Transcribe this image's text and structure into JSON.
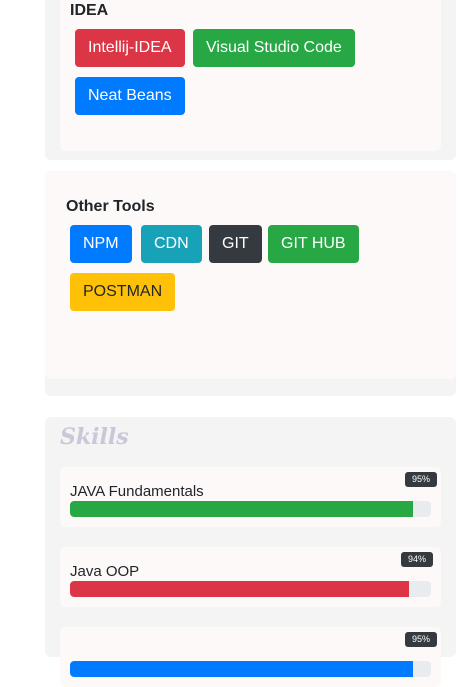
{
  "idea": {
    "title": "IDEA",
    "buttons": [
      {
        "label": "Intellij-IDEA",
        "color": "#dc3545"
      },
      {
        "label": "Visual Studio Code",
        "color": "#28a745"
      },
      {
        "label": "Neat Beans",
        "color": "#007bff"
      }
    ]
  },
  "tools": {
    "title": "Other Tools",
    "buttons": [
      {
        "label": "NPM",
        "color": "#007bff"
      },
      {
        "label": "CDN",
        "color": "#17a2b8"
      },
      {
        "label": "GIT",
        "color": "#343a40"
      },
      {
        "label": "GIT HUB",
        "color": "#28a745"
      },
      {
        "label": "POSTMAN",
        "color": "#ffc107",
        "text_color": "#212529"
      }
    ]
  },
  "skills": {
    "title": "Skills",
    "items": [
      {
        "name": "JAVA Fundamentals",
        "percent_label": "95%",
        "percent": 95,
        "color": "#28a745"
      },
      {
        "name": "Java OOP",
        "percent_label": "94%",
        "percent": 94,
        "color": "#dc3545"
      },
      {
        "name": "",
        "percent_label": "95%",
        "percent": 95,
        "color": "#007bff"
      }
    ]
  }
}
